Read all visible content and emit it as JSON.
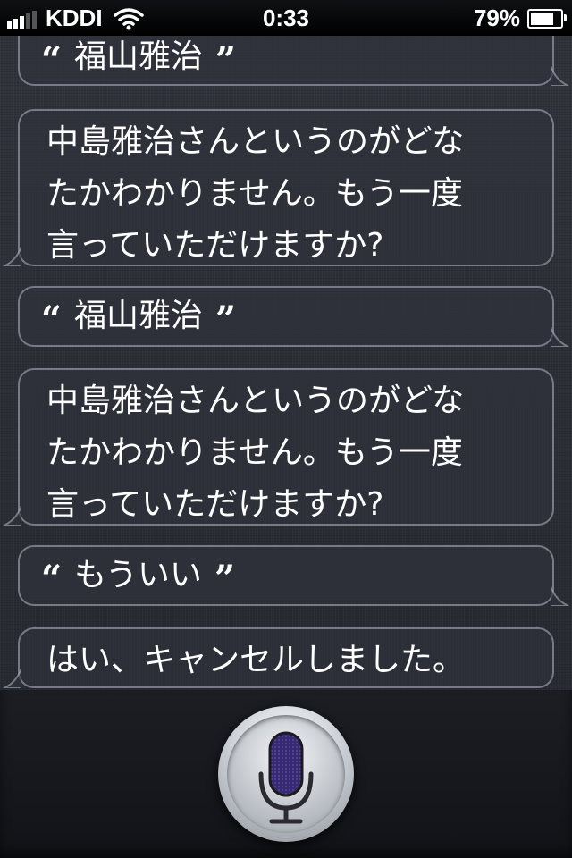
{
  "status_bar": {
    "carrier": "KDDI",
    "time": "0:33",
    "battery_percent": "79%",
    "battery_level": 0.79,
    "signal_bars": 3
  },
  "conversation": {
    "messages": [
      {
        "role": "user",
        "text": "福山雅治"
      },
      {
        "role": "siri",
        "lines": [
          "中島雅治さんというのがどな",
          "たかわかりません。もう一度",
          "言っていただけますか?"
        ]
      },
      {
        "role": "user",
        "text": "福山雅治"
      },
      {
        "role": "siri",
        "lines": [
          "中島雅治さんというのがどな",
          "たかわかりません。もう一度",
          "言っていただけますか?"
        ]
      },
      {
        "role": "user",
        "text": "もういい"
      },
      {
        "role": "siri",
        "lines": [
          "はい、キャンセルしました。"
        ]
      }
    ],
    "quote_open": "“",
    "quote_close": "”"
  },
  "icons": {
    "wifi": "wifi-icon",
    "battery": "battery-icon",
    "microphone": "microphone-icon"
  },
  "colors": {
    "mic_accent": "#4a3a8c"
  }
}
